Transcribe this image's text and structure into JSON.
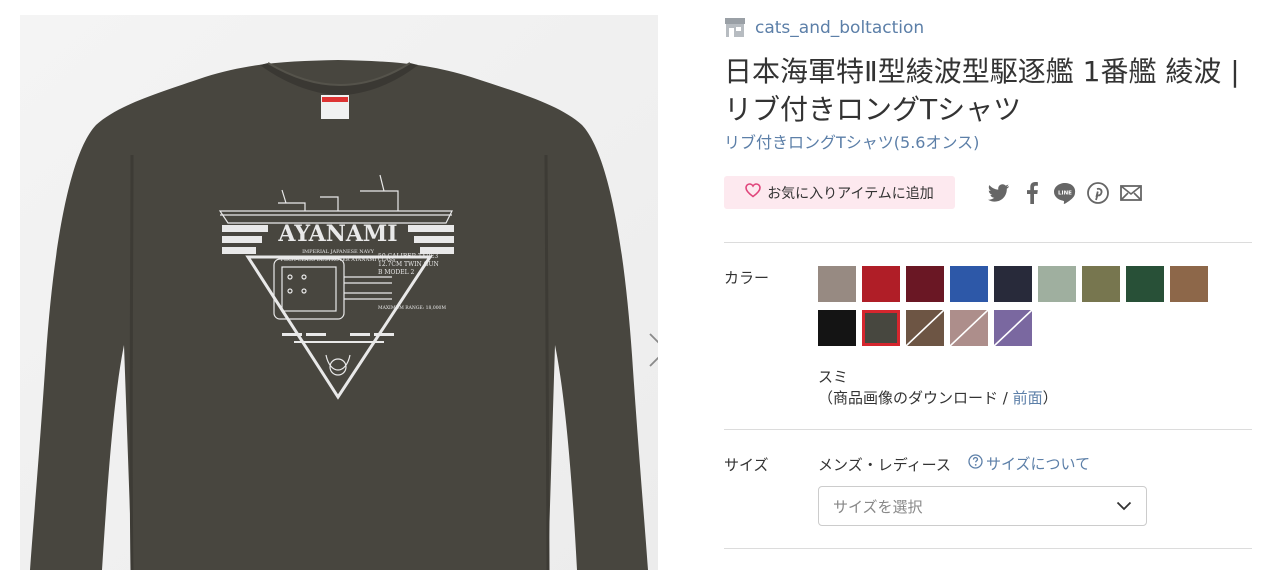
{
  "shop": {
    "name": "cats_and_boltaction",
    "icon": "shop-icon"
  },
  "product": {
    "title": "日本海軍特Ⅱ型綾波型駆逐艦 1番艦 綾波 | リブ付きロングTシャツ",
    "type_link": "リブ付きロングTシャツ(5.6オンス)"
  },
  "image": {
    "print_title": "AYANAMI",
    "print_sub1": "IMPERIAL JAPANESE NAVY",
    "print_sub2": "FIRST-CLASS DESTROYER  AYANAMI CLASS",
    "print_spec1": "50 CALIBER TYPE3",
    "print_spec2": "12.7CM TWIN GUN",
    "print_spec3": "B MODEL 2",
    "print_range": "MAXIMUM RANGE: 18,000M",
    "next_icon": "chevron-right-icon"
  },
  "favorite": {
    "label": "お気に入りアイテムに追加",
    "icon": "heart-icon",
    "color": "#e0457b"
  },
  "share_icons": [
    "twitter-icon",
    "facebook-icon",
    "line-icon",
    "pinterest-icon",
    "mail-icon"
  ],
  "color": {
    "label": "カラー",
    "swatches": [
      {
        "name": "light-gray",
        "fill": "#978a82"
      },
      {
        "name": "red",
        "fill": "#b01e27"
      },
      {
        "name": "burgundy",
        "fill": "#6a1724"
      },
      {
        "name": "royal-blue",
        "fill": "#2d58a8"
      },
      {
        "name": "navy",
        "fill": "#282a3a"
      },
      {
        "name": "sage",
        "fill": "#9faf9f"
      },
      {
        "name": "olive",
        "fill": "#77764f"
      },
      {
        "name": "forest-green",
        "fill": "#285037"
      },
      {
        "name": "brown",
        "fill": "#8d6749"
      },
      {
        "name": "black",
        "fill": "#141414"
      },
      {
        "name": "sumi",
        "fill": "#47473f",
        "selected": true
      },
      {
        "name": "heather-brown",
        "fill": "#6d5544",
        "diagonal": true
      },
      {
        "name": "heather-pink",
        "fill": "#ad8e8b",
        "diagonal": true
      },
      {
        "name": "heather-purple",
        "fill": "#7a68a0",
        "diagonal": true
      }
    ],
    "selected_name": "スミ",
    "download_prefix": "（商品画像のダウンロード / ",
    "download_link": "前面",
    "download_suffix": "）"
  },
  "size": {
    "label": "サイズ",
    "category": "メンズ・レディース",
    "guide_label": "サイズについて",
    "guide_icon": "question-circle-icon",
    "select_placeholder": "サイズを選択",
    "select_icon": "chevron-down-icon"
  }
}
